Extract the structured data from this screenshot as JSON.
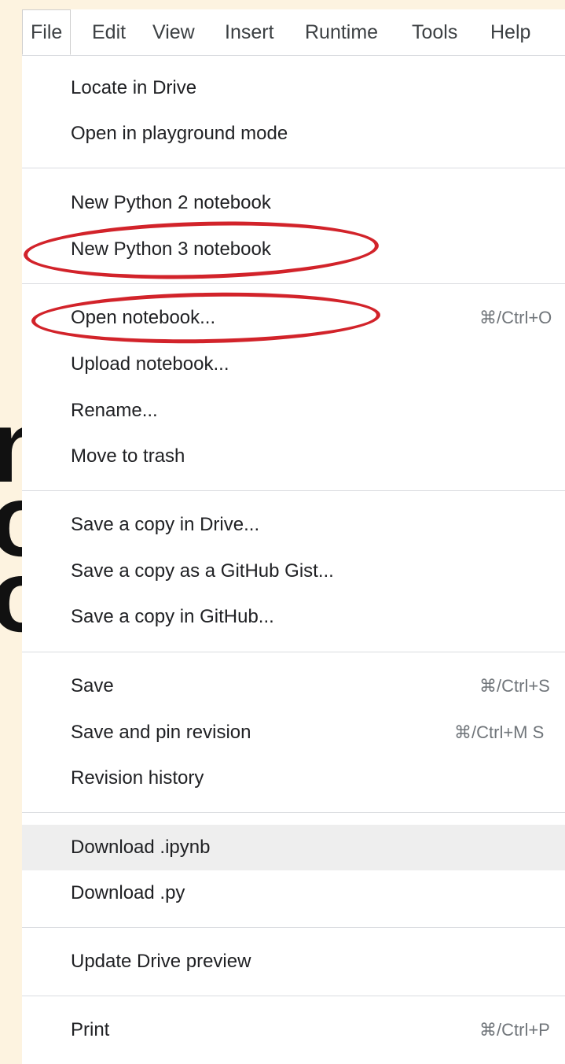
{
  "background_glyphs": [
    "n",
    "o",
    "o"
  ],
  "menubar": {
    "items": [
      "File",
      "Edit",
      "View",
      "Insert",
      "Runtime",
      "Tools",
      "Help"
    ],
    "active": "File"
  },
  "file_menu": {
    "groups": [
      {
        "items": [
          {
            "label": "Locate in Drive",
            "shortcut": ""
          },
          {
            "label": "Open in playground mode",
            "shortcut": ""
          }
        ]
      },
      {
        "items": [
          {
            "label": "New Python 2 notebook",
            "shortcut": ""
          },
          {
            "label": "New Python 3 notebook",
            "shortcut": ""
          }
        ]
      },
      {
        "items": [
          {
            "label": "Open notebook...",
            "shortcut": "⌘/Ctrl+O"
          },
          {
            "label": "Upload notebook...",
            "shortcut": ""
          },
          {
            "label": "Rename...",
            "shortcut": ""
          },
          {
            "label": "Move to trash",
            "shortcut": ""
          }
        ]
      },
      {
        "items": [
          {
            "label": "Save a copy in Drive...",
            "shortcut": ""
          },
          {
            "label": "Save a copy as a GitHub Gist...",
            "shortcut": ""
          },
          {
            "label": "Save a copy in GitHub...",
            "shortcut": ""
          }
        ]
      },
      {
        "items": [
          {
            "label": "Save",
            "shortcut": "⌘/Ctrl+S"
          },
          {
            "label": "Save and pin revision",
            "shortcut": "⌘/Ctrl+M S"
          },
          {
            "label": "Revision history",
            "shortcut": ""
          }
        ]
      },
      {
        "items": [
          {
            "label": "Download .ipynb",
            "shortcut": ""
          },
          {
            "label": "Download .py",
            "shortcut": ""
          }
        ]
      },
      {
        "items": [
          {
            "label": "Update Drive preview",
            "shortcut": ""
          }
        ]
      },
      {
        "items": [
          {
            "label": "Print",
            "shortcut": "⌘/Ctrl+P"
          }
        ]
      }
    ],
    "hovered_item": "Download .ipynb"
  },
  "annotations": {
    "circled_items": [
      "New Python 3 notebook",
      "Open notebook..."
    ],
    "circle_color": "#d2232a"
  },
  "colors": {
    "page_background": "#fdf3e0",
    "menu_background": "#ffffff",
    "separator": "#dadce0",
    "hover": "#eeeeee",
    "text": "#202124",
    "shortcut_text": "#70757a"
  }
}
